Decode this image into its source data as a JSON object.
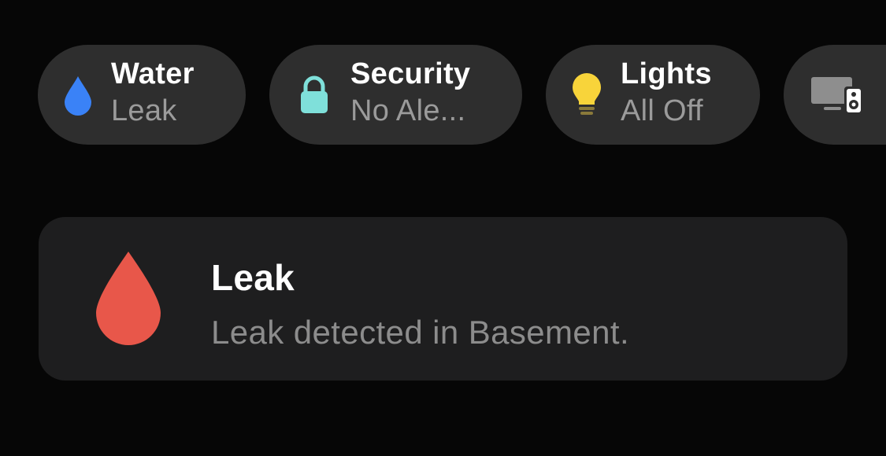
{
  "status_pills": [
    {
      "title": "Water",
      "subtitle": "Leak",
      "icon": "water-drop-icon",
      "icon_color": "#3a82f7"
    },
    {
      "title": "Security",
      "subtitle": "No Ale...",
      "icon": "lock-icon",
      "icon_color": "#7fe0da"
    },
    {
      "title": "Lights",
      "subtitle": "All Off",
      "icon": "lightbulb-icon",
      "icon_color": "#f8d43a"
    },
    {
      "title": "",
      "subtitle": "",
      "icon": "tv-speaker-icon",
      "icon_color": "#8e8e8e"
    }
  ],
  "alert_card": {
    "title": "Leak",
    "message": "Leak detected in Basement.",
    "icon": "water-drop-icon",
    "icon_color": "#e8574a"
  },
  "colors": {
    "background": "#060606",
    "pill_background": "#2e2e2e",
    "card_background": "#1e1e1f",
    "primary_text": "#ffffff",
    "secondary_text": "#9b9b9b"
  }
}
